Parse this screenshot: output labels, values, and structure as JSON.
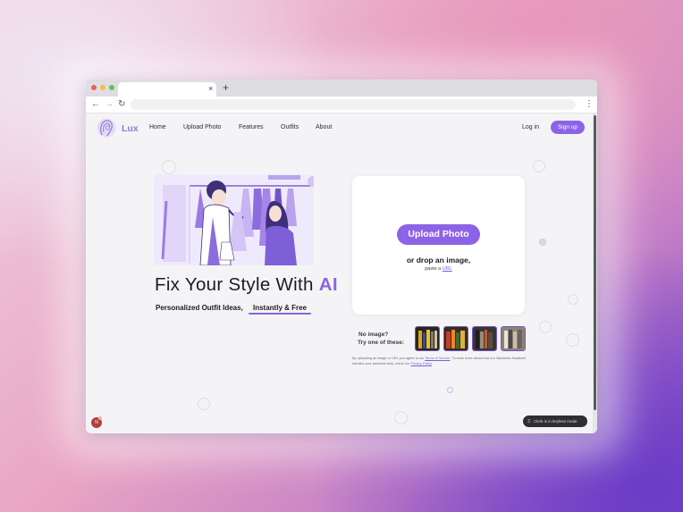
{
  "browser": {
    "tab_close_icon": "×",
    "new_tab_icon": "+",
    "back_icon": "←",
    "forward_icon": "→",
    "reload_icon": "↻",
    "menu_icon": "⋮"
  },
  "site": {
    "brand": "Lux",
    "nav": [
      "Home",
      "Upload Photo",
      "Features",
      "Outfits",
      "About"
    ],
    "login": "Log in",
    "signup": "Sign up",
    "accent_color": "#8c63e6"
  },
  "hero": {
    "title_prefix": "Fix Your Style With ",
    "title_highlight": "AI",
    "subtitle_part1": "Personalized Outfit Ideas,",
    "subtitle_part2": "Instantly & Free"
  },
  "upload": {
    "button": "Upload Photo",
    "drop_text": "or drop an image,",
    "paste_prefix": "paste a ",
    "paste_link": "URL",
    "no_image_line1": "No image?",
    "no_image_line2": "Try one of these:",
    "terms_part1": "By uploading an image or URL you agree to our ",
    "terms_link1": "Terms of Service",
    "terms_part2": ". To learn more about how our Wardrobe Assistant handles your personal data, check our ",
    "terms_link2": "Privacy Policy",
    "terms_part3": "."
  },
  "footer": {
    "keyless_text": "Clerk is in keyless mode",
    "avatar_initial": "N"
  }
}
